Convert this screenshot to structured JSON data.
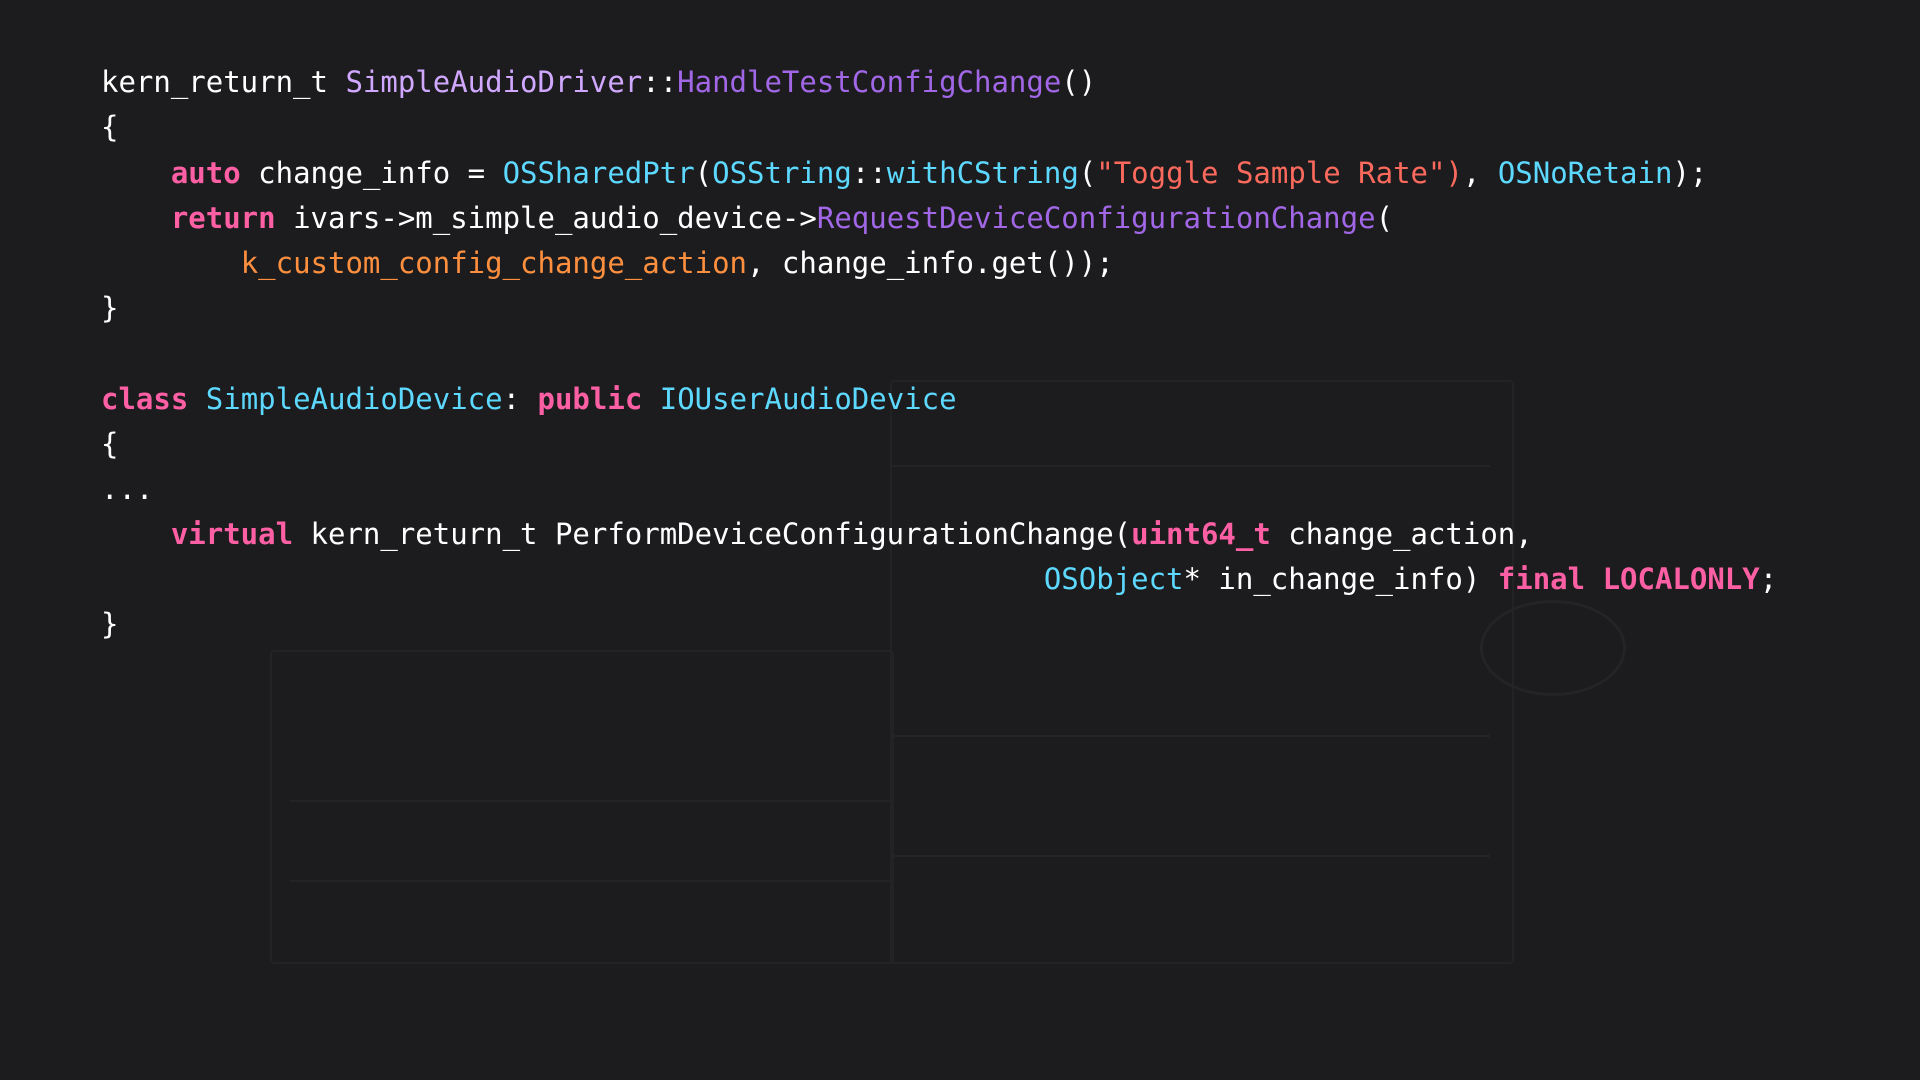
{
  "code": {
    "lines": [
      [
        {
          "t": "kern_return_t ",
          "c": "plain"
        },
        {
          "t": "SimpleAudioDriver",
          "c": "cls"
        },
        {
          "t": "::",
          "c": "plain"
        },
        {
          "t": "HandleTestConfigChange",
          "c": "fn"
        },
        {
          "t": "()",
          "c": "plain"
        }
      ],
      [
        {
          "t": "{",
          "c": "plain"
        }
      ],
      [
        {
          "t": "    ",
          "c": "plain"
        },
        {
          "t": "auto",
          "c": "kw"
        },
        {
          "t": " change_info = ",
          "c": "plain"
        },
        {
          "t": "OSSharedPtr",
          "c": "typ"
        },
        {
          "t": "(",
          "c": "plain"
        },
        {
          "t": "OSString",
          "c": "typ"
        },
        {
          "t": "::",
          "c": "plain"
        },
        {
          "t": "withCString",
          "c": "typ"
        },
        {
          "t": "(",
          "c": "plain"
        },
        {
          "t": "\"Toggle Sample Rate\")",
          "c": "str"
        },
        {
          "t": ", ",
          "c": "plain"
        },
        {
          "t": "OSNoRetain",
          "c": "typ"
        },
        {
          "t": ");",
          "c": "plain"
        }
      ],
      [
        {
          "t": "    ",
          "c": "plain"
        },
        {
          "t": "return",
          "c": "kw"
        },
        {
          "t": " ivars->m_simple_audio_device->",
          "c": "plain"
        },
        {
          "t": "RequestDeviceConfigurationChange",
          "c": "fn"
        },
        {
          "t": "(",
          "c": "plain"
        }
      ],
      [
        {
          "t": "        ",
          "c": "plain"
        },
        {
          "t": "k_custom_config_change_action",
          "c": "cst"
        },
        {
          "t": ", change_info.get());",
          "c": "plain"
        }
      ],
      [
        {
          "t": "}",
          "c": "plain"
        }
      ],
      [
        {
          "t": "",
          "c": "plain"
        }
      ],
      [
        {
          "t": "class",
          "c": "kw"
        },
        {
          "t": " ",
          "c": "plain"
        },
        {
          "t": "SimpleAudioDevice",
          "c": "typ"
        },
        {
          "t": ": ",
          "c": "plain"
        },
        {
          "t": "public",
          "c": "kw"
        },
        {
          "t": " ",
          "c": "plain"
        },
        {
          "t": "IOUserAudioDevice",
          "c": "typ"
        }
      ],
      [
        {
          "t": "{",
          "c": "plain"
        }
      ],
      [
        {
          "t": "...",
          "c": "plain"
        }
      ],
      [
        {
          "t": "    ",
          "c": "plain"
        },
        {
          "t": "virtual",
          "c": "kw"
        },
        {
          "t": " kern_return_t PerformDeviceConfigurationChange(",
          "c": "plain"
        },
        {
          "t": "uint64_t",
          "c": "kw"
        },
        {
          "t": " change_action,",
          "c": "plain"
        }
      ],
      [
        {
          "t": "                                                      ",
          "c": "plain"
        },
        {
          "t": "OSObject",
          "c": "typ"
        },
        {
          "t": "* in_change_info) ",
          "c": "plain"
        },
        {
          "t": "final",
          "c": "kw"
        },
        {
          "t": " ",
          "c": "plain"
        },
        {
          "t": "LOCALONLY",
          "c": "kw"
        },
        {
          "t": ";",
          "c": "plain"
        }
      ],
      [
        {
          "t": "}",
          "c": "plain"
        }
      ]
    ]
  },
  "colors": {
    "background": "#1c1c1e",
    "keyword": "#fc5fa3",
    "class_name": "#d0a8ff",
    "function": "#a167e6",
    "type": "#5dd8ff",
    "string": "#fc6a5d",
    "constant": "#fd8f3f",
    "plain": "#ffffff"
  }
}
